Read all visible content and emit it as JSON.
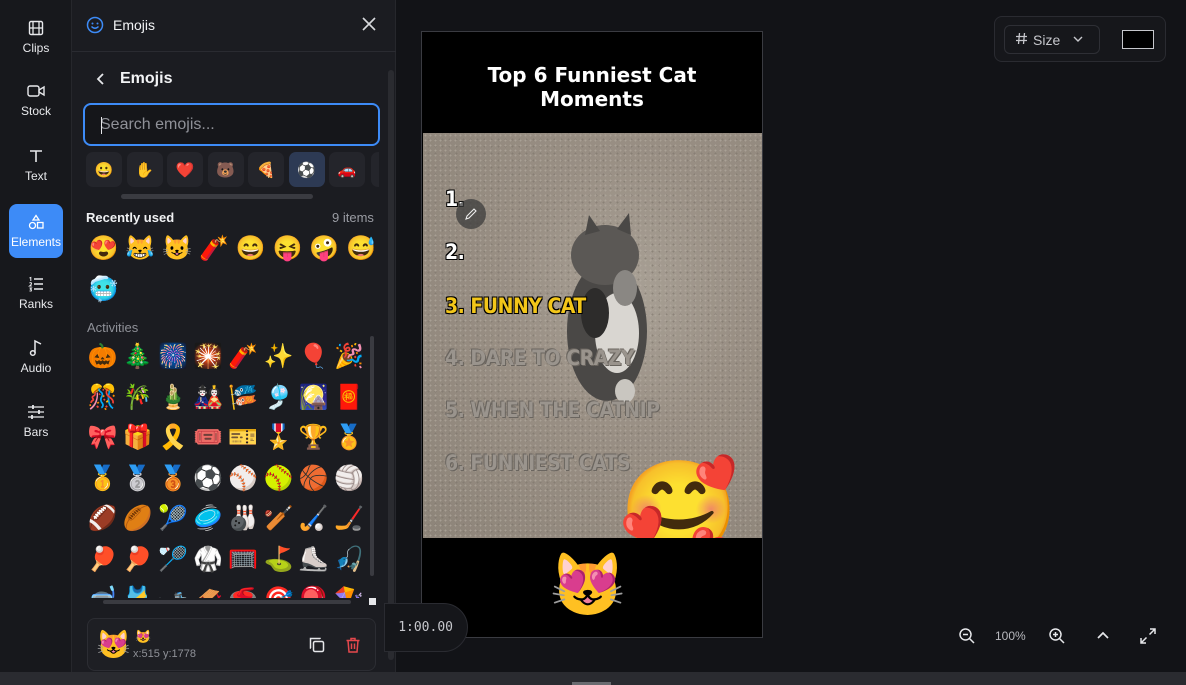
{
  "nav": {
    "items": [
      {
        "label": "Clips",
        "icon": "film-icon"
      },
      {
        "label": "Stock",
        "icon": "video-camera-icon"
      },
      {
        "label": "Text",
        "icon": "text-icon"
      },
      {
        "label": "Elements",
        "icon": "shapes-icon",
        "active": true
      },
      {
        "label": "Ranks",
        "icon": "list-ordered-icon"
      },
      {
        "label": "Audio",
        "icon": "music-note-icon"
      },
      {
        "label": "Bars",
        "icon": "sliders-icon"
      }
    ]
  },
  "panel": {
    "title": "Emojis",
    "subtitle": "Emojis",
    "search_placeholder": "Search emojis...",
    "categories": [
      "😀",
      "✋",
      "❤️",
      "🐻",
      "🍕",
      "⚽",
      "🚗"
    ],
    "selected_category_index": 5,
    "recent": {
      "label": "Recently used",
      "count": "9 items",
      "emojis": [
        "😍",
        "😹",
        "😺",
        "🧨",
        "😄",
        "😝",
        "🤪",
        "😅",
        "🥶"
      ]
    },
    "activities": {
      "label": "Activities",
      "emojis": [
        "🎃",
        "🎄",
        "🎆",
        "🎇",
        "🧨",
        "✨",
        "🎈",
        "🎉",
        "🎊",
        "🎋",
        "🎍",
        "🎎",
        "🎏",
        "🎐",
        "🎑",
        "🧧",
        "🎀",
        "🎁",
        "🎗️",
        "🎟️",
        "🎫",
        "🎖️",
        "🏆",
        "🏅",
        "🥇",
        "🥈",
        "🥉",
        "⚽",
        "⚾",
        "🥎",
        "🏀",
        "🏐",
        "🏈",
        "🏉",
        "🎾",
        "🥏",
        "🎳",
        "🏏",
        "🏑",
        "🏒",
        "🏓",
        "🏓",
        "🏸",
        "🥋",
        "🥅",
        "⛳",
        "⛸️",
        "🎣",
        "🤿",
        "🎽",
        "🎿",
        "🛷",
        "🥌",
        "🎯",
        "🪀",
        "🪁"
      ]
    },
    "selected": {
      "emoji": "😻",
      "small_emoji": "😻",
      "coords": "x:515 y:1778"
    }
  },
  "toolbar": {
    "size_label": "Size",
    "color": "#000000"
  },
  "preview": {
    "title_line1": "Top 6 Funniest Cat",
    "title_line2": "Moments",
    "ranks": [
      "1.",
      "2.",
      "3. FUNNY CAT",
      "4. DARE TO CRAZY",
      "5. WHEN THE CATNIP",
      "6. FUNNIEST CATS"
    ],
    "sticker_video": "🥰",
    "sticker_bottom": "😻"
  },
  "timeline": {
    "time": "1:00.00"
  },
  "zoom": {
    "level": "100%"
  },
  "colors": {
    "accent": "#3d8bf7",
    "rank_highlight": "#f3c619",
    "danger": "#e5484d"
  }
}
